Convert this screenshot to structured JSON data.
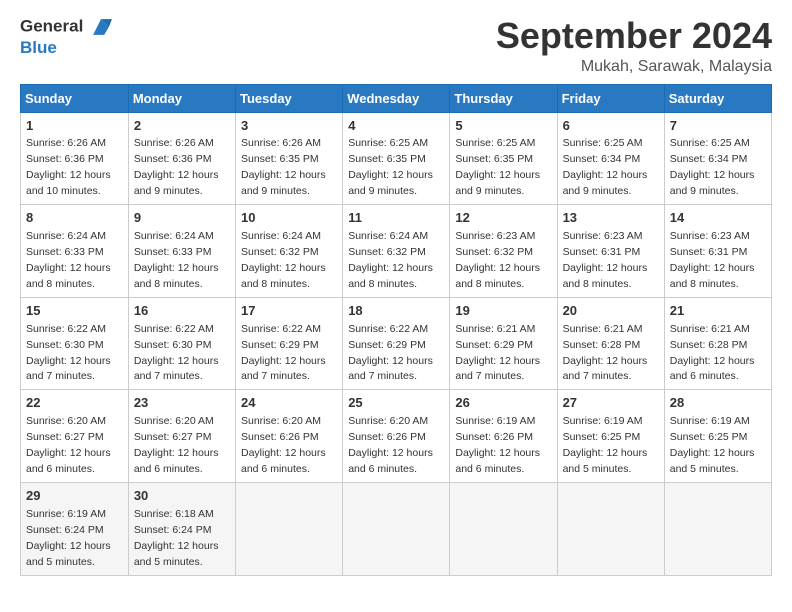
{
  "header": {
    "logo_line1": "General",
    "logo_line2": "Blue",
    "month": "September 2024",
    "location": "Mukah, Sarawak, Malaysia"
  },
  "weekdays": [
    "Sunday",
    "Monday",
    "Tuesday",
    "Wednesday",
    "Thursday",
    "Friday",
    "Saturday"
  ],
  "weeks": [
    [
      {
        "day": "1",
        "sunrise": "6:26 AM",
        "sunset": "6:36 PM",
        "daylight": "12 hours and 10 minutes."
      },
      {
        "day": "2",
        "sunrise": "6:26 AM",
        "sunset": "6:36 PM",
        "daylight": "12 hours and 9 minutes."
      },
      {
        "day": "3",
        "sunrise": "6:26 AM",
        "sunset": "6:35 PM",
        "daylight": "12 hours and 9 minutes."
      },
      {
        "day": "4",
        "sunrise": "6:25 AM",
        "sunset": "6:35 PM",
        "daylight": "12 hours and 9 minutes."
      },
      {
        "day": "5",
        "sunrise": "6:25 AM",
        "sunset": "6:35 PM",
        "daylight": "12 hours and 9 minutes."
      },
      {
        "day": "6",
        "sunrise": "6:25 AM",
        "sunset": "6:34 PM",
        "daylight": "12 hours and 9 minutes."
      },
      {
        "day": "7",
        "sunrise": "6:25 AM",
        "sunset": "6:34 PM",
        "daylight": "12 hours and 9 minutes."
      }
    ],
    [
      {
        "day": "8",
        "sunrise": "6:24 AM",
        "sunset": "6:33 PM",
        "daylight": "12 hours and 8 minutes."
      },
      {
        "day": "9",
        "sunrise": "6:24 AM",
        "sunset": "6:33 PM",
        "daylight": "12 hours and 8 minutes."
      },
      {
        "day": "10",
        "sunrise": "6:24 AM",
        "sunset": "6:32 PM",
        "daylight": "12 hours and 8 minutes."
      },
      {
        "day": "11",
        "sunrise": "6:24 AM",
        "sunset": "6:32 PM",
        "daylight": "12 hours and 8 minutes."
      },
      {
        "day": "12",
        "sunrise": "6:23 AM",
        "sunset": "6:32 PM",
        "daylight": "12 hours and 8 minutes."
      },
      {
        "day": "13",
        "sunrise": "6:23 AM",
        "sunset": "6:31 PM",
        "daylight": "12 hours and 8 minutes."
      },
      {
        "day": "14",
        "sunrise": "6:23 AM",
        "sunset": "6:31 PM",
        "daylight": "12 hours and 8 minutes."
      }
    ],
    [
      {
        "day": "15",
        "sunrise": "6:22 AM",
        "sunset": "6:30 PM",
        "daylight": "12 hours and 7 minutes."
      },
      {
        "day": "16",
        "sunrise": "6:22 AM",
        "sunset": "6:30 PM",
        "daylight": "12 hours and 7 minutes."
      },
      {
        "day": "17",
        "sunrise": "6:22 AM",
        "sunset": "6:29 PM",
        "daylight": "12 hours and 7 minutes."
      },
      {
        "day": "18",
        "sunrise": "6:22 AM",
        "sunset": "6:29 PM",
        "daylight": "12 hours and 7 minutes."
      },
      {
        "day": "19",
        "sunrise": "6:21 AM",
        "sunset": "6:29 PM",
        "daylight": "12 hours and 7 minutes."
      },
      {
        "day": "20",
        "sunrise": "6:21 AM",
        "sunset": "6:28 PM",
        "daylight": "12 hours and 7 minutes."
      },
      {
        "day": "21",
        "sunrise": "6:21 AM",
        "sunset": "6:28 PM",
        "daylight": "12 hours and 6 minutes."
      }
    ],
    [
      {
        "day": "22",
        "sunrise": "6:20 AM",
        "sunset": "6:27 PM",
        "daylight": "12 hours and 6 minutes."
      },
      {
        "day": "23",
        "sunrise": "6:20 AM",
        "sunset": "6:27 PM",
        "daylight": "12 hours and 6 minutes."
      },
      {
        "day": "24",
        "sunrise": "6:20 AM",
        "sunset": "6:26 PM",
        "daylight": "12 hours and 6 minutes."
      },
      {
        "day": "25",
        "sunrise": "6:20 AM",
        "sunset": "6:26 PM",
        "daylight": "12 hours and 6 minutes."
      },
      {
        "day": "26",
        "sunrise": "6:19 AM",
        "sunset": "6:26 PM",
        "daylight": "12 hours and 6 minutes."
      },
      {
        "day": "27",
        "sunrise": "6:19 AM",
        "sunset": "6:25 PM",
        "daylight": "12 hours and 5 minutes."
      },
      {
        "day": "28",
        "sunrise": "6:19 AM",
        "sunset": "6:25 PM",
        "daylight": "12 hours and 5 minutes."
      }
    ],
    [
      {
        "day": "29",
        "sunrise": "6:19 AM",
        "sunset": "6:24 PM",
        "daylight": "12 hours and 5 minutes."
      },
      {
        "day": "30",
        "sunrise": "6:18 AM",
        "sunset": "6:24 PM",
        "daylight": "12 hours and 5 minutes."
      },
      null,
      null,
      null,
      null,
      null
    ]
  ]
}
